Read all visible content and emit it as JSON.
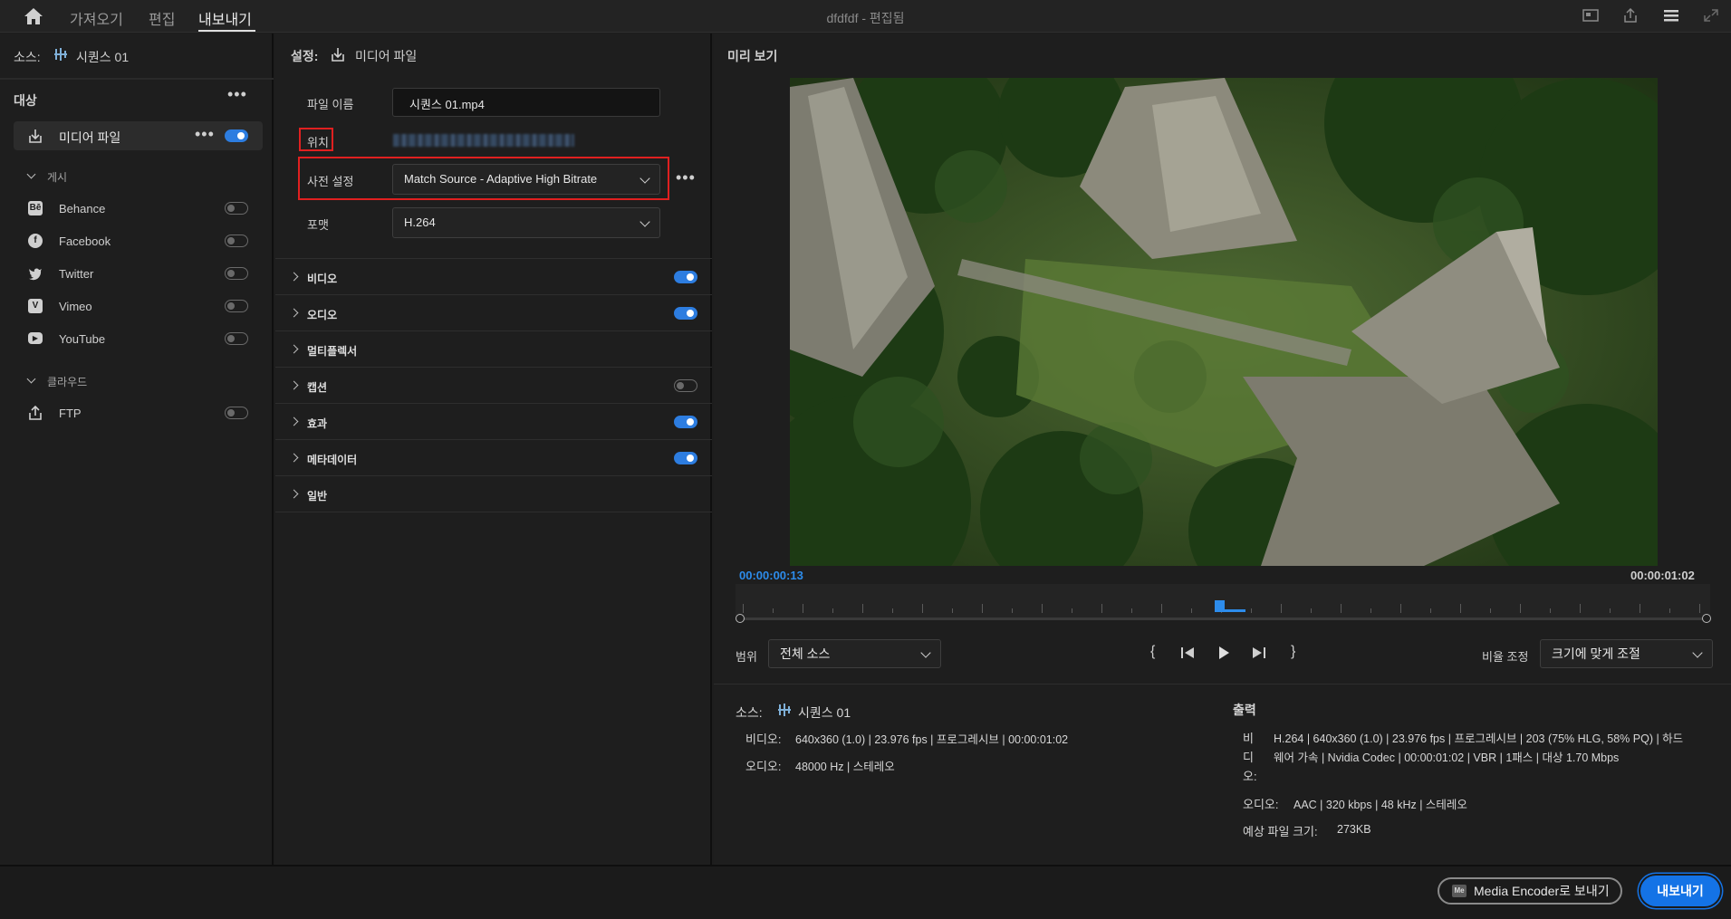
{
  "topbar": {
    "tabs": [
      "가져오기",
      "편집",
      "내보내기"
    ],
    "title": "dfdfdf",
    "title_suffix": " - 편집됨"
  },
  "source": {
    "label": "소스:",
    "name": "시퀀스 01"
  },
  "left": {
    "targets_title": "대상",
    "media_file_label": "미디어 파일",
    "media_file_on": true,
    "publish_title": "게시",
    "publish_items": [
      {
        "label": "Behance",
        "icon": "behance-icon",
        "on": false
      },
      {
        "label": "Facebook",
        "icon": "facebook-icon",
        "on": false
      },
      {
        "label": "Twitter",
        "icon": "twitter-icon",
        "on": false
      },
      {
        "label": "Vimeo",
        "icon": "vimeo-icon",
        "on": false
      },
      {
        "label": "YouTube",
        "icon": "youtube-icon",
        "on": false
      }
    ],
    "cloud_title": "클라우드",
    "ftp_label": "FTP",
    "ftp_on": false
  },
  "settings": {
    "title_label": "설정:",
    "title_value": "미디어 파일",
    "filename_label": "파일 이름",
    "filename_value": "시퀀스 01.mp4",
    "location_label": "위치",
    "preset_label": "사전 설정",
    "preset_value": "Match Source - Adaptive High Bitrate",
    "format_label": "포맷",
    "format_value": "H.264",
    "sections": [
      {
        "label": "비디오",
        "on": true
      },
      {
        "label": "오디오",
        "on": true
      },
      {
        "label": "멀티플렉서",
        "on": null
      },
      {
        "label": "캡션",
        "on": false
      },
      {
        "label": "효과",
        "on": true
      },
      {
        "label": "메타데이터",
        "on": true
      },
      {
        "label": "일반",
        "on": null
      }
    ]
  },
  "preview": {
    "title": "미리 보기",
    "current_time": "00:00:00:13",
    "duration": "00:00:01:02",
    "range_label": "범위",
    "range_value": "전체 소스",
    "scale_label": "비율 조정",
    "scale_value": "크기에 맞게 조절",
    "accent_color": "#2d8ceb"
  },
  "source_info": {
    "label": "소스:",
    "name": "시퀀스 01",
    "video_label": "비디오:",
    "video_value": "640x360 (1.0)  |  23.976 fps  |  프로그레시브  |  00:00:01:02",
    "audio_label": "오디오:",
    "audio_value": "48000 Hz  |  스테레오"
  },
  "output_info": {
    "title": "출력",
    "video_label_lines": [
      "비",
      "디",
      "오:"
    ],
    "video_line1": "H.264  |  640x360 (1.0)  |  23.976 fps  |  프로그레시브  |  203 (75% HLG, 58% PQ)  |  하드",
    "video_line2": "웨어 가속  |  Nvidia Codec  |  00:00:01:02   |  VBR  |  1패스  |  대상 1.70 Mbps",
    "audio_label": "오디오:",
    "audio_value": "AAC  |  320 kbps  |  48 kHz  |  스테레오",
    "size_label": "예상 파일 크기:",
    "size_value": "273KB"
  },
  "footer": {
    "media_encoder_button": "Media Encoder로 보내기",
    "export_button": "내보내기"
  }
}
